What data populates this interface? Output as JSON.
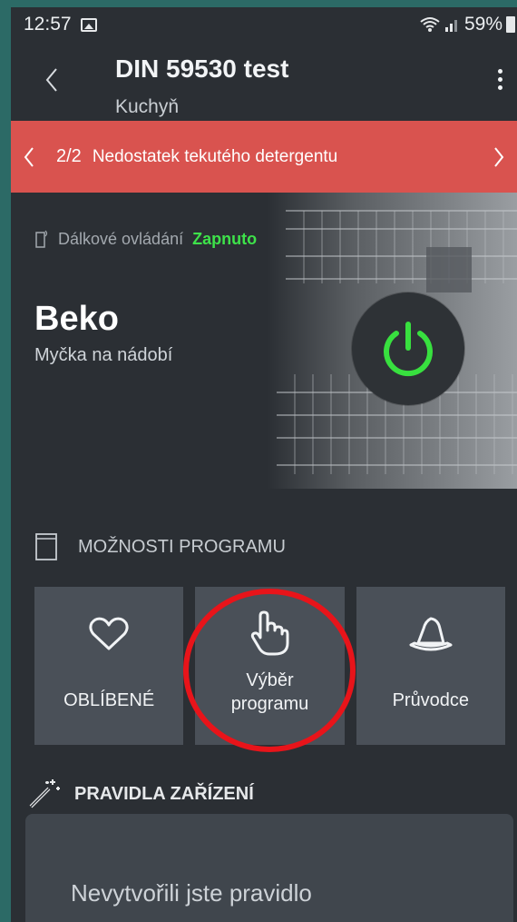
{
  "status": {
    "time": "12:57",
    "battery": "59%"
  },
  "header": {
    "title": "DIN 59530 test",
    "subtitle": "Kuchyň"
  },
  "alert": {
    "counter": "2/2",
    "message": "Nedostatek tekutého detergentu"
  },
  "device": {
    "remote_label": "Dálkové ovládání",
    "remote_state": "Zapnuto",
    "brand": "Beko",
    "type": "Myčka na nádobí"
  },
  "program_options": {
    "heading": "MOŽNOSTI PROGRAMU",
    "tiles": [
      {
        "label": "OBLÍBENÉ",
        "icon": "heart-icon"
      },
      {
        "label_line1": "Výběr",
        "label_line2": "programu",
        "icon": "hand-pointer-icon"
      },
      {
        "label": "Průvodce",
        "icon": "wizard-hat-icon"
      }
    ]
  },
  "rules": {
    "heading": "PRAVIDLA ZAŘÍZENÍ",
    "empty_text": "Nevytvořili jste pravidlo"
  },
  "colors": {
    "alert": "#d9534f",
    "accent_green": "#3ee24a",
    "annotation_red": "#e8141a"
  }
}
